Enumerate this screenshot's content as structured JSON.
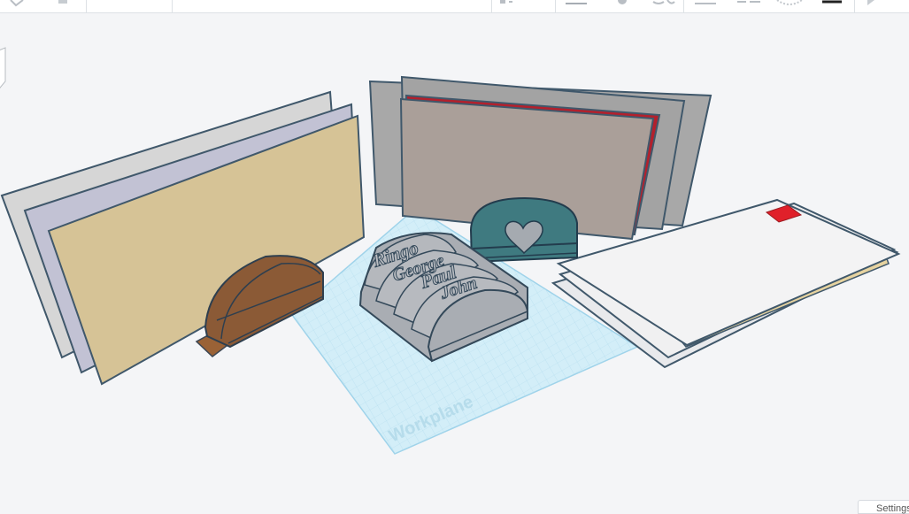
{
  "toolbar": {
    "icons": [
      "group-icon",
      "ungroup-icon",
      "align-icon",
      "mirror-icon",
      "flip-icon",
      "note-icon",
      "ruler-icon",
      "grid-icon",
      "shape-lights-icon",
      "workplane-icon",
      "simulate-icon"
    ]
  },
  "scene": {
    "workplane_label": "Workplane",
    "name_tags": [
      "Ringo",
      "George",
      "Paul",
      "John"
    ],
    "colors": {
      "workplane": "#cfeaf6",
      "brown_holder": "#8b5a36",
      "grey_holder": "#a9adb3",
      "teal_holder": "#3f7a80",
      "tan_card": "#d6c396",
      "lavender_card": "#bdbfd2",
      "taupe_card": "#a99c96",
      "red_stripe": "#b3202c",
      "stamp": "#e0202a"
    }
  },
  "settings": {
    "label": "Settings"
  }
}
